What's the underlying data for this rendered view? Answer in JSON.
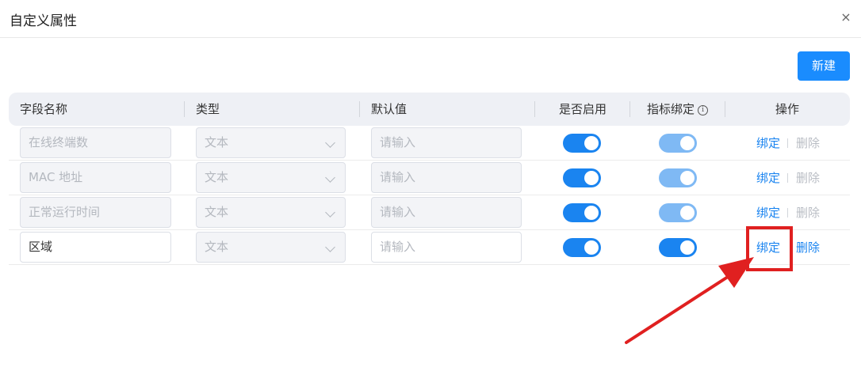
{
  "dialog": {
    "title": "自定义属性",
    "close_icon": "×",
    "new_button": "新建"
  },
  "table": {
    "columns": {
      "field_name": "字段名称",
      "type": "类型",
      "default_value": "默认值",
      "enabled": "是否启用",
      "indicator_binding": "指标绑定",
      "actions": "操作"
    },
    "info_icon": "i",
    "rows": [
      {
        "field_name": "在线终端数",
        "type": "文本",
        "default_placeholder": "请输入",
        "enabled": true,
        "indicator_binding": true,
        "bind_label": "绑定",
        "delete_label": "删除"
      },
      {
        "field_name": "MAC 地址",
        "type": "文本",
        "default_placeholder": "请输入",
        "enabled": true,
        "indicator_binding": true,
        "bind_label": "绑定",
        "delete_label": "删除"
      },
      {
        "field_name": "正常运行时间",
        "type": "文本",
        "default_placeholder": "请输入",
        "enabled": true,
        "indicator_binding": true,
        "bind_label": "绑定",
        "delete_label": "删除"
      },
      {
        "field_name": "区域",
        "type": "文本",
        "default_placeholder": "请输入",
        "enabled": true,
        "indicator_binding": true,
        "bind_label": "绑定",
        "delete_label": "删除"
      }
    ]
  },
  "colors": {
    "primary": "#1a8cfe",
    "toggle_on": "#1a84f0",
    "toggle_disabled": "#7fb9f4",
    "annotation": "#e02020"
  }
}
